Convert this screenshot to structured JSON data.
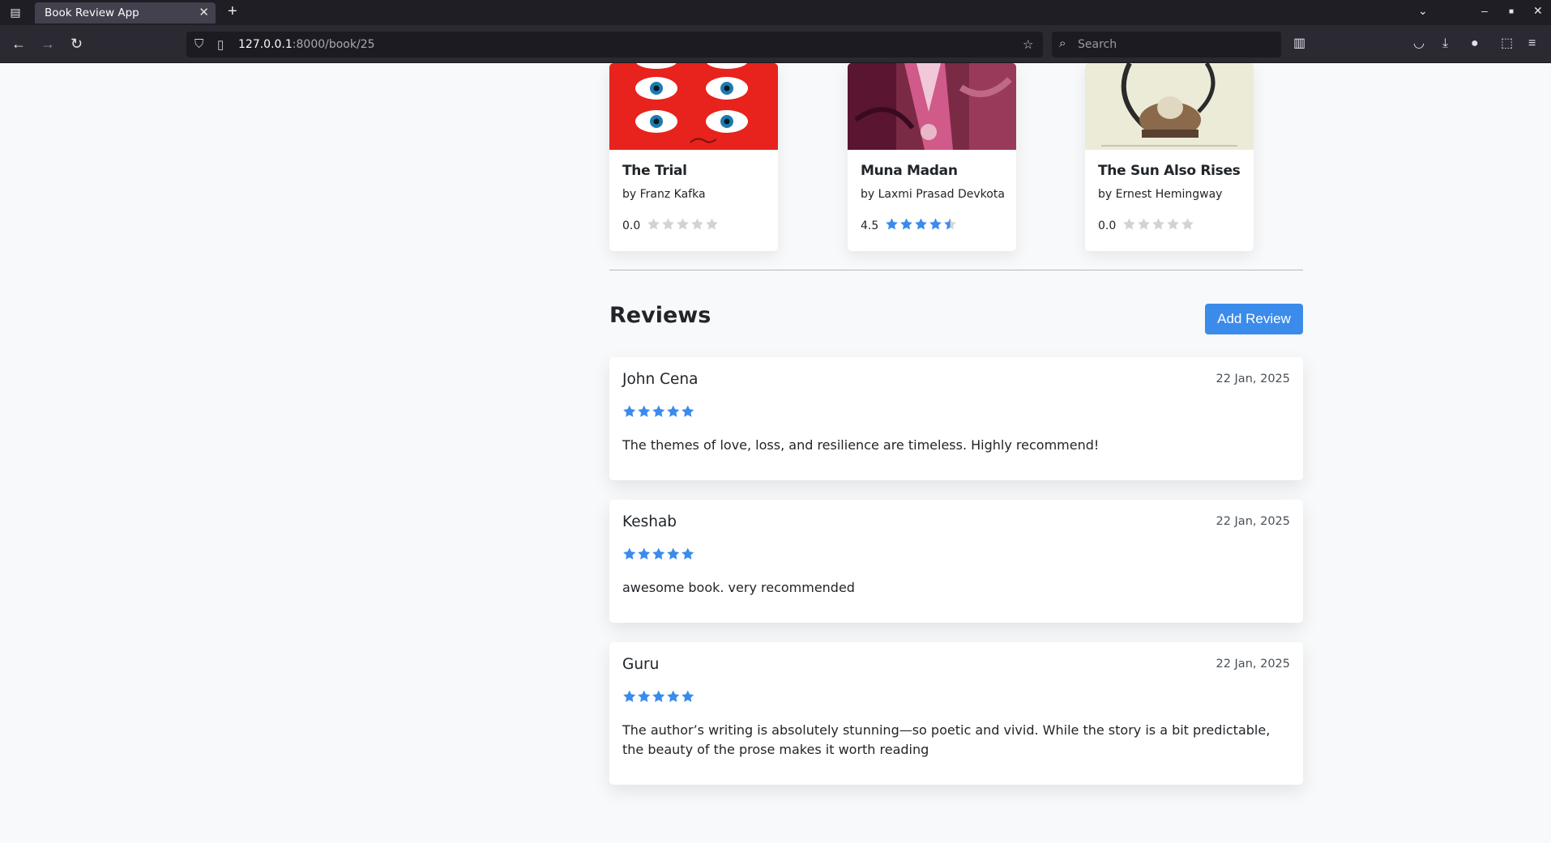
{
  "browser": {
    "tab_title": "Book Review App",
    "url_host": "127.0.0.1",
    "url_path": ":8000/book/25",
    "search_placeholder": "Search"
  },
  "colors": {
    "accent": "#3b8beb",
    "star_filled": "#3b8beb",
    "star_empty": "#d3d3d3"
  },
  "books": [
    {
      "title": "The Trial",
      "author": "by Franz Kafka",
      "rating_text": "0.0",
      "rating": 0.0
    },
    {
      "title": "Muna Madan",
      "author": "by Laxmi Prasad Devkota",
      "rating_text": "4.5",
      "rating": 4.5
    },
    {
      "title": "The Sun Also Rises",
      "author": "by Ernest Hemingway",
      "rating_text": "0.0",
      "rating": 0.0
    }
  ],
  "reviews_section": {
    "title": "Reviews",
    "add_button": "Add Review"
  },
  "reviews": [
    {
      "name": "John Cena",
      "date": "22 Jan, 2025",
      "rating": 5,
      "text": "The themes of love, loss, and resilience are timeless. Highly recommend!"
    },
    {
      "name": "Keshab",
      "date": "22 Jan, 2025",
      "rating": 5,
      "text": "awesome book. very recommended"
    },
    {
      "name": "Guru",
      "date": "22 Jan, 2025",
      "rating": 5,
      "text": "The author’s writing is absolutely stunning—so poetic and vivid. While the story is a bit predictable, the beauty of the prose makes it worth reading"
    }
  ]
}
